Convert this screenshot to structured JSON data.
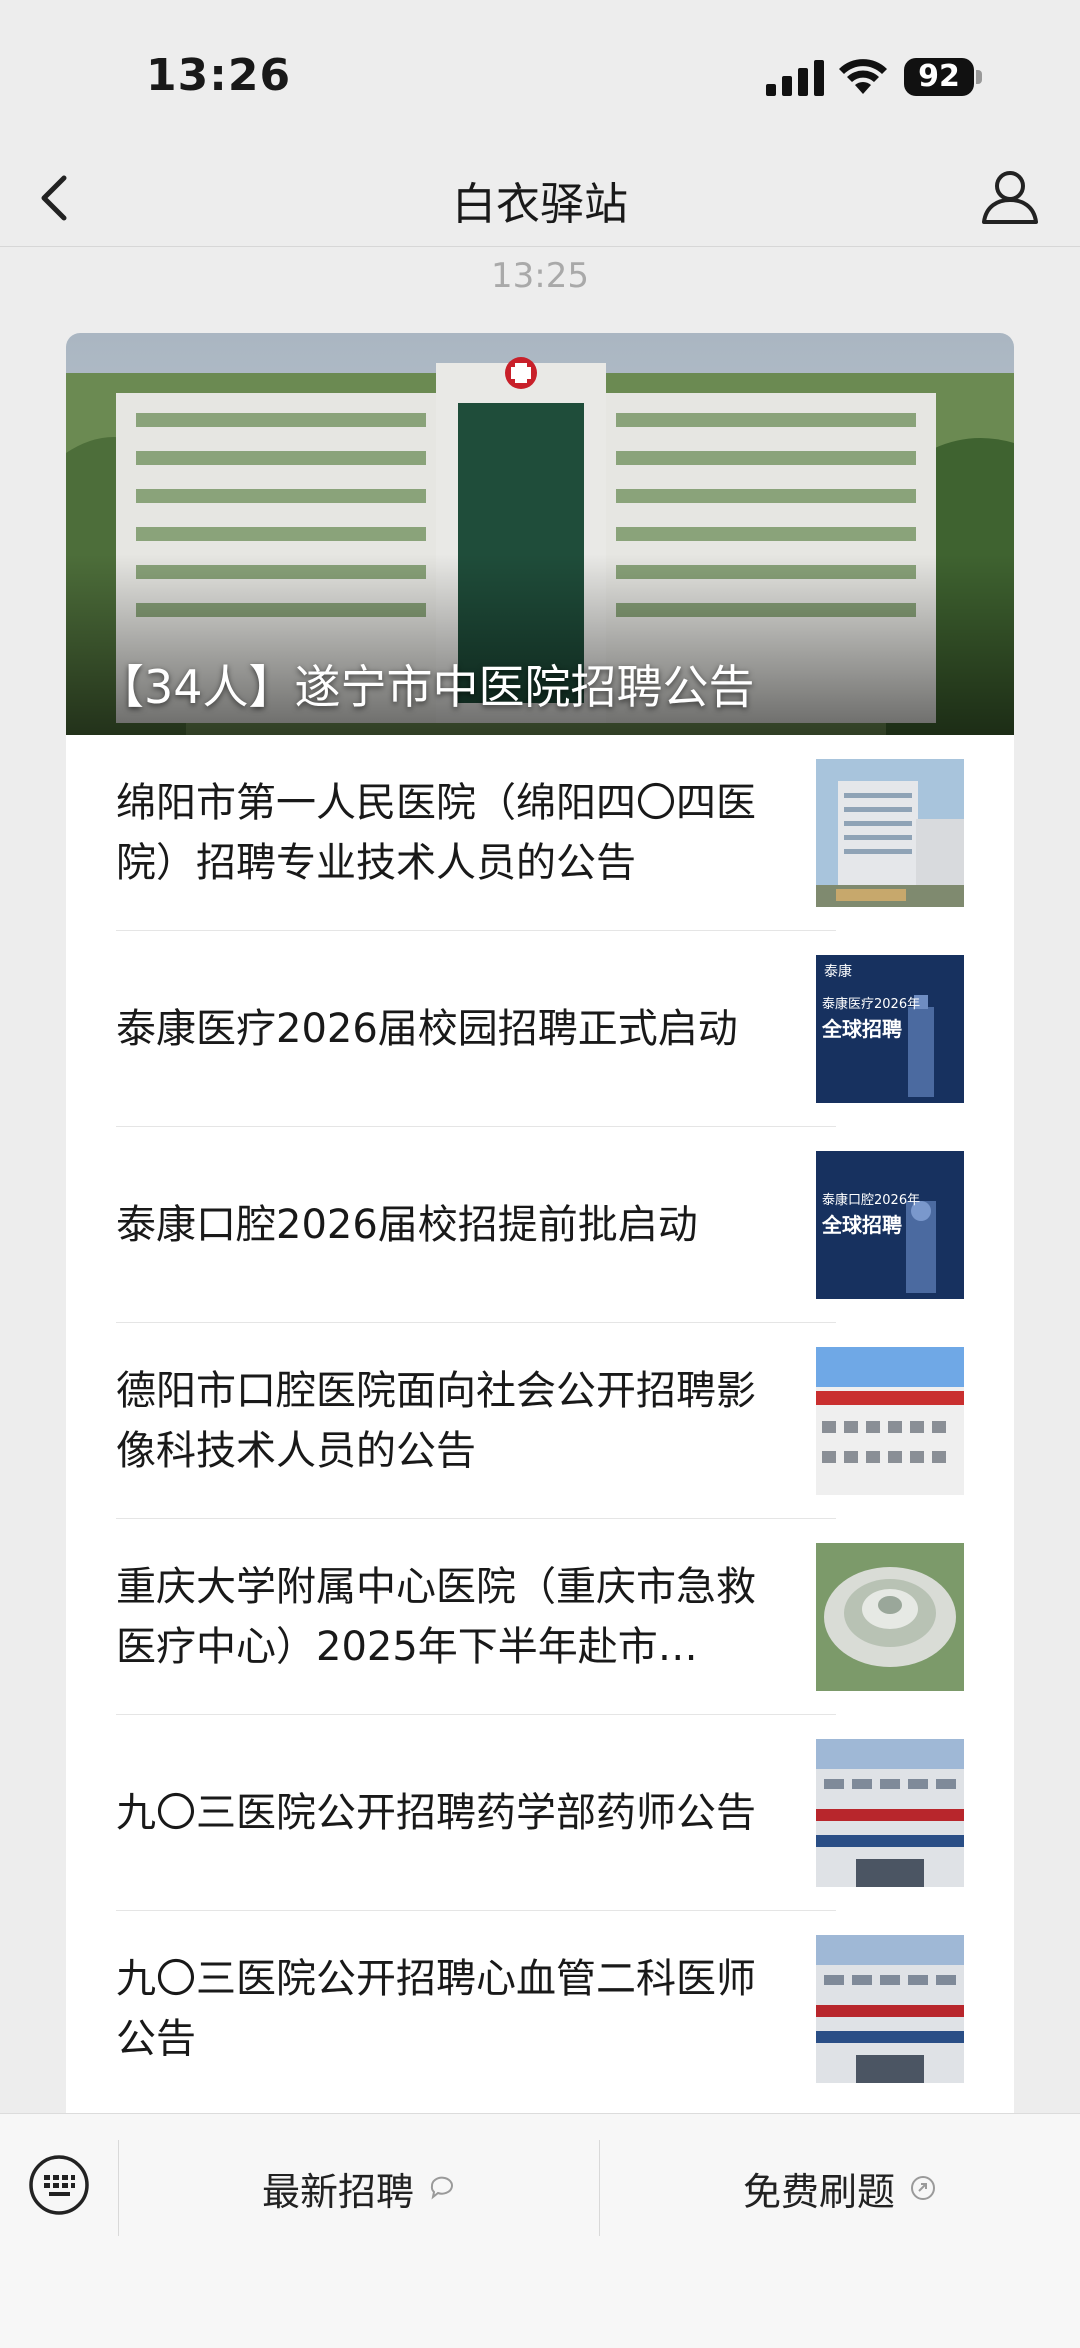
{
  "status_bar": {
    "time": "13:26",
    "battery": "92"
  },
  "nav": {
    "title": "白衣驿站"
  },
  "message_time": "13:25",
  "article": {
    "headline": "【34人】遂宁市中医院招聘公告",
    "items": [
      {
        "title": "绵阳市第一人民医院（绵阳四〇四医院）招聘专业技术人员的公告"
      },
      {
        "title": "泰康医疗2026届校园招聘正式启动"
      },
      {
        "title": "泰康口腔2026届校招提前批启动"
      },
      {
        "title": "德阳市口腔医院面向社会公开招聘影像科技术人员的公告"
      },
      {
        "title": "重庆大学附属中心医院（重庆市急救医疗中心）2025年下半年赴市…"
      },
      {
        "title": "九〇三医院公开招聘药学部药师公告"
      },
      {
        "title": "九〇三医院公开招聘心血管二科医师公告"
      }
    ]
  },
  "thumbs": {
    "t2_brand": "泰康",
    "t2_sub": "泰康医疗2026年",
    "t2_main": "全球招聘",
    "t3_sub": "泰康口腔2026年",
    "t3_main": "全球招聘"
  },
  "menu": {
    "items": [
      {
        "label": "最新招聘"
      },
      {
        "label": "免费刷题"
      }
    ]
  }
}
